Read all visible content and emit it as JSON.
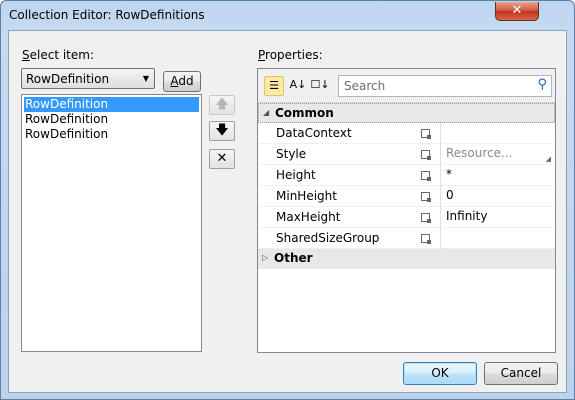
{
  "window": {
    "title": "Collection Editor: RowDefinitions",
    "close_glyph": "✕"
  },
  "left": {
    "select_label_accel": "S",
    "select_label_rest": "elect item:",
    "combo_value": "RowDefinition",
    "add_accel": "A",
    "add_rest": "dd",
    "items": [
      "RowDefinition",
      "RowDefinition",
      "RowDefinition"
    ],
    "selected_index": 0
  },
  "side_buttons": {
    "move_up_glyph": "🡅",
    "move_down_glyph": "🡇",
    "remove_glyph": "✕"
  },
  "right": {
    "properties_label_accel": "P",
    "properties_label_rest": "roperties:",
    "search_placeholder": "Search",
    "toolbar": {
      "categorized_glyph": "☰",
      "alpha_glyph": "A↓",
      "filter_glyph": "☐↓"
    },
    "categories": [
      {
        "name": "Common",
        "expanded": true,
        "properties": [
          {
            "name": "DataContext",
            "value": ""
          },
          {
            "name": "Style",
            "value": "Resource..."
          },
          {
            "name": "Height",
            "value": "*"
          },
          {
            "name": "MinHeight",
            "value": "0"
          },
          {
            "name": "MaxHeight",
            "value": "Infinity"
          },
          {
            "name": "SharedSizeGroup",
            "value": ""
          }
        ]
      },
      {
        "name": "Other",
        "expanded": false
      }
    ]
  },
  "footer": {
    "ok_label": "OK",
    "cancel_label": "Cancel"
  },
  "colors": {
    "selection": "#3399ff",
    "title_bar": "#bcd5ef",
    "close_button": "#c2321c",
    "client_bg": "#f0f0f0"
  }
}
